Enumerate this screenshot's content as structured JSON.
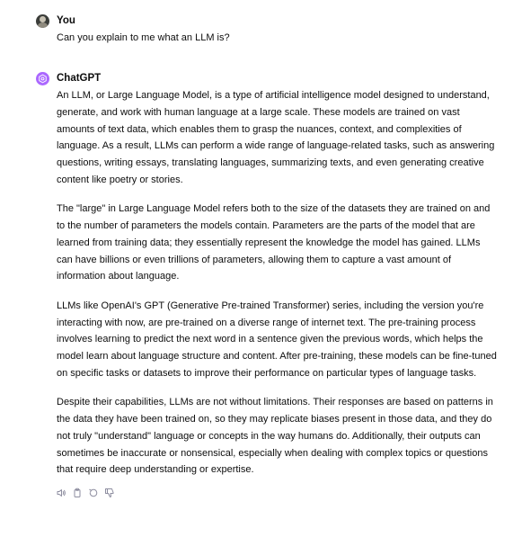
{
  "user_message": {
    "author": "You",
    "text": "Can you explain to me what an LLM is?"
  },
  "assistant_message": {
    "author": "ChatGPT",
    "paragraphs": [
      "An LLM, or Large Language Model, is a type of artificial intelligence model designed to understand, generate, and work with human language at a large scale. These models are trained on vast amounts of text data, which enables them to grasp the nuances, context, and complexities of language. As a result, LLMs can perform a wide range of language-related tasks, such as answering questions, writing essays, translating languages, summarizing texts, and even generating creative content like poetry or stories.",
      "The \"large\" in Large Language Model refers both to the size of the datasets they are trained on and to the number of parameters the models contain. Parameters are the parts of the model that are learned from training data; they essentially represent the knowledge the model has gained. LLMs can have billions or even trillions of parameters, allowing them to capture a vast amount of information about language.",
      "LLMs like OpenAI's GPT (Generative Pre-trained Transformer) series, including the version you're interacting with now, are pre-trained on a diverse range of internet text. The pre-training process involves learning to predict the next word in a sentence given the previous words, which helps the model learn about language structure and content. After pre-training, these models can be fine-tuned on specific tasks or datasets to improve their performance on particular types of language tasks.",
      "Despite their capabilities, LLMs are not without limitations. Their responses are based on patterns in the data they have been trained on, so they may replicate biases present in those data, and they do not truly \"understand\" language or concepts in the way humans do. Additionally, their outputs can sometimes be inaccurate or nonsensical, especially when dealing with complex topics or questions that require deep understanding or expertise."
    ],
    "actions": [
      "speaker-icon",
      "copy-icon",
      "regenerate-icon",
      "thumbs-down-icon"
    ]
  },
  "colors": {
    "bot_avatar": "#ab68ff",
    "text": "#0d0d0d",
    "icon": "#8e8ea0"
  }
}
